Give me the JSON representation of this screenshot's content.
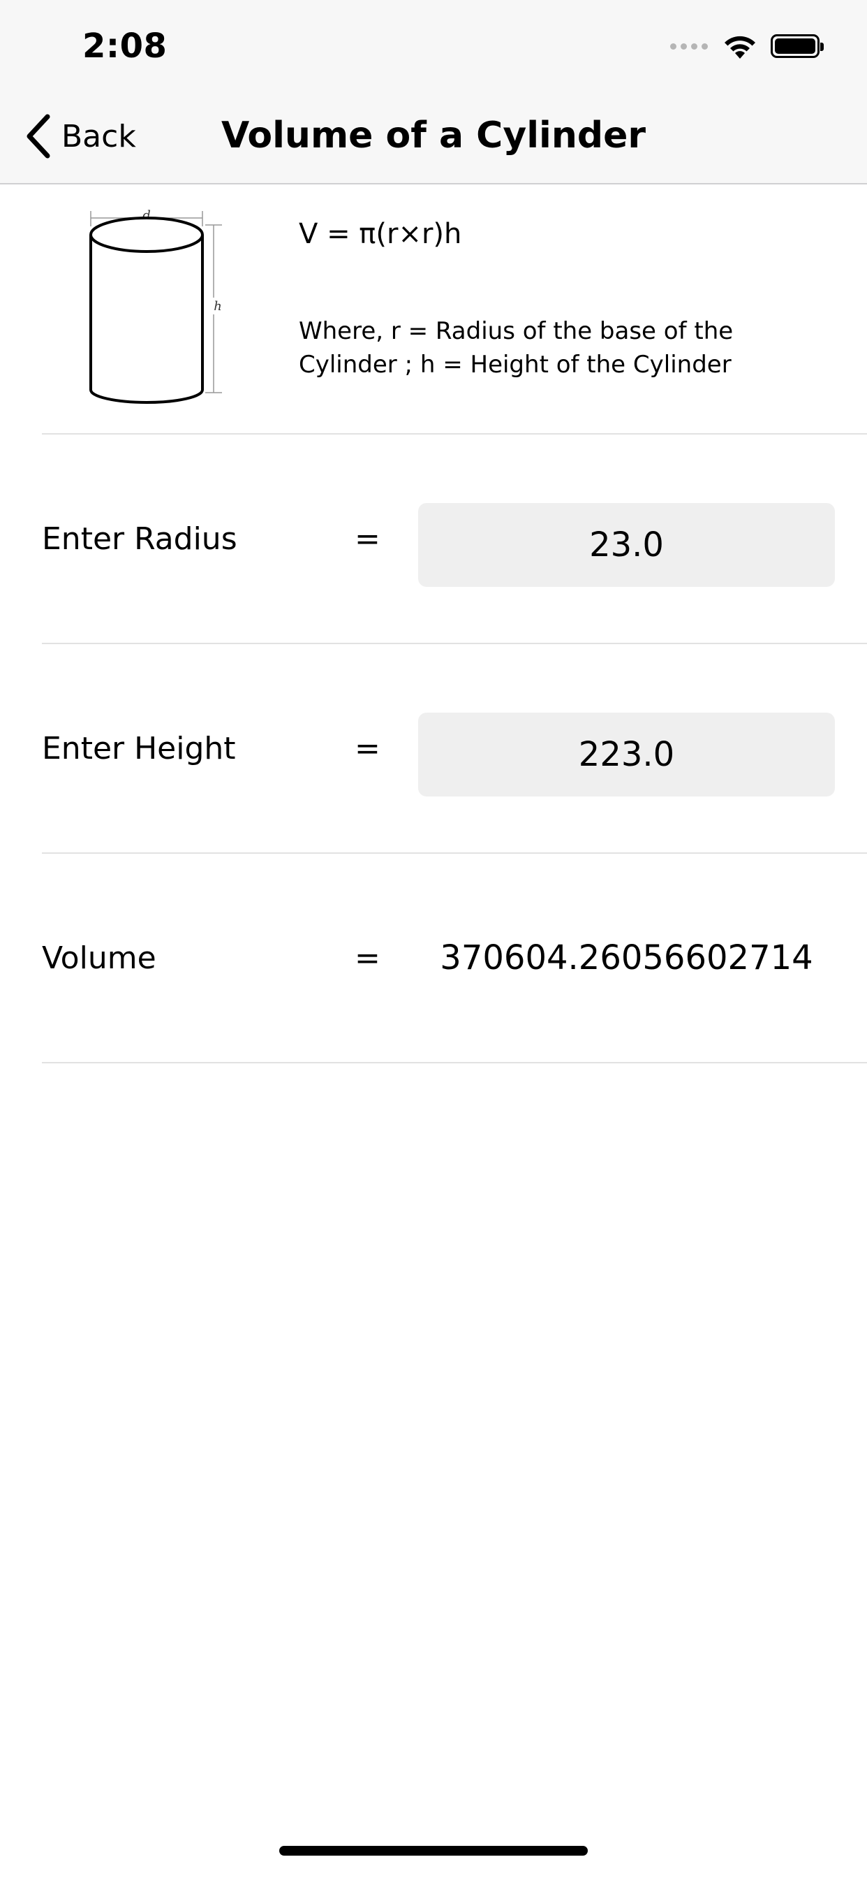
{
  "status_bar": {
    "time": "2:08"
  },
  "nav": {
    "back_label": "Back",
    "title": "Volume of a Cylinder"
  },
  "formula": {
    "equation": "V = π(r×r)h",
    "explanation": "Where, r = Radius of the base of the Cylinder ; h = Height of the Cylinder",
    "diagram_labels": {
      "diameter": "d",
      "height": "h"
    }
  },
  "rows": {
    "radius": {
      "label": "Enter Radius",
      "equals": "=",
      "value": "23.0"
    },
    "height": {
      "label": "Enter Height",
      "equals": "=",
      "value": "223.0"
    },
    "volume": {
      "label": "Volume",
      "equals": "=",
      "value": "370604.26056602714"
    }
  },
  "icons": {
    "back": "chevron-left-icon",
    "wifi": "wifi-icon",
    "battery": "battery-icon",
    "signal": "cellular-signal-icon"
  }
}
